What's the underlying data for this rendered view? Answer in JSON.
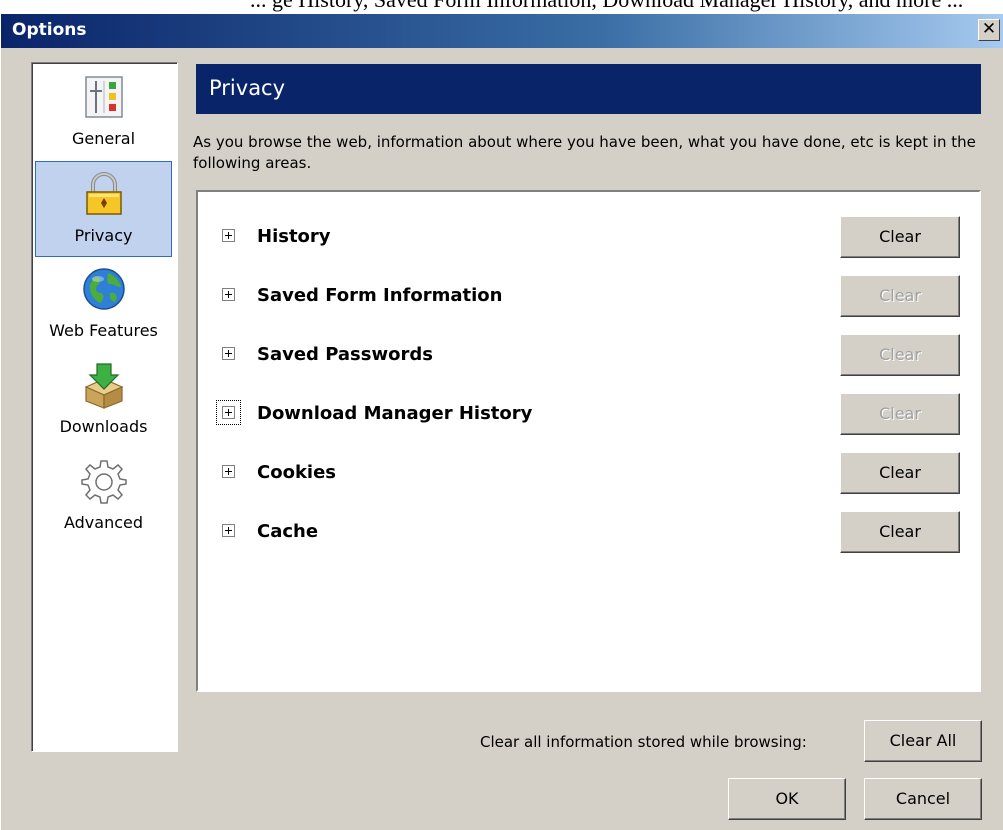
{
  "top_strip_text": "... ge History, Saved Form Information, Download Manager History, and more ...",
  "window": {
    "title": "Options",
    "close_label": "✕"
  },
  "sidebar": {
    "items": [
      {
        "label": "General",
        "icon": "sliders-icon",
        "selected": false
      },
      {
        "label": "Privacy",
        "icon": "padlock-icon",
        "selected": true
      },
      {
        "label": "Web Features",
        "icon": "globe-icon",
        "selected": false
      },
      {
        "label": "Downloads",
        "icon": "download-box-icon",
        "selected": false
      },
      {
        "label": "Advanced",
        "icon": "gear-icon",
        "selected": false
      }
    ]
  },
  "panel": {
    "title": "Privacy",
    "description": "As you browse the web, information about where you have been, what you have done, etc is kept in the following areas."
  },
  "privacy_items": [
    {
      "label": "History",
      "button": "Clear",
      "enabled": true
    },
    {
      "label": "Saved Form Information",
      "button": "Clear",
      "enabled": false
    },
    {
      "label": "Saved Passwords",
      "button": "Clear",
      "enabled": false
    },
    {
      "label": "Download Manager History",
      "button": "Clear",
      "enabled": false
    },
    {
      "label": "Cookies",
      "button": "Clear",
      "enabled": true
    },
    {
      "label": "Cache",
      "button": "Clear",
      "enabled": true
    }
  ],
  "footer": {
    "clear_all_text": "Clear all information stored while browsing:",
    "clear_all_button": "Clear All",
    "ok_button": "OK",
    "cancel_button": "Cancel"
  },
  "colors": {
    "title_bar_start": "#0a246a",
    "title_bar_end": "#a6caf0",
    "header_bg": "#0a246a",
    "selection_bg": "#c1d2ee",
    "dialog_bg": "#d4d0c8"
  }
}
